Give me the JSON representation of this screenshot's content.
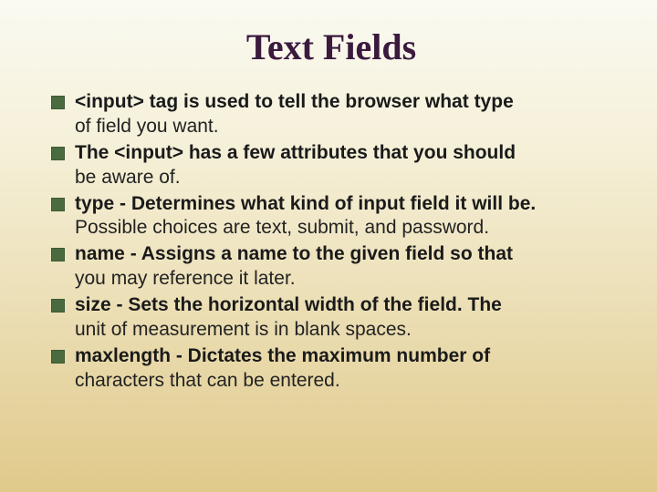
{
  "title": "Text Fields",
  "bullets": [
    {
      "lead": "<input> tag is used to tell the browser what type",
      "rest": "of field you want."
    },
    {
      "lead": "The <input> has a few attributes that you should",
      "rest": "be aware of."
    },
    {
      "lead": "type - Determines what kind of input field it will be.",
      "rest": "Possible choices are text, submit, and password."
    },
    {
      "lead": "name - Assigns a name to the given field so that",
      "rest": "you may reference it later."
    },
    {
      "lead": "size - Sets the horizontal width of the field. The",
      "rest": "unit of measurement is in blank spaces."
    },
    {
      "lead": "maxlength - Dictates the maximum number of",
      "rest": "characters that can be entered."
    }
  ]
}
